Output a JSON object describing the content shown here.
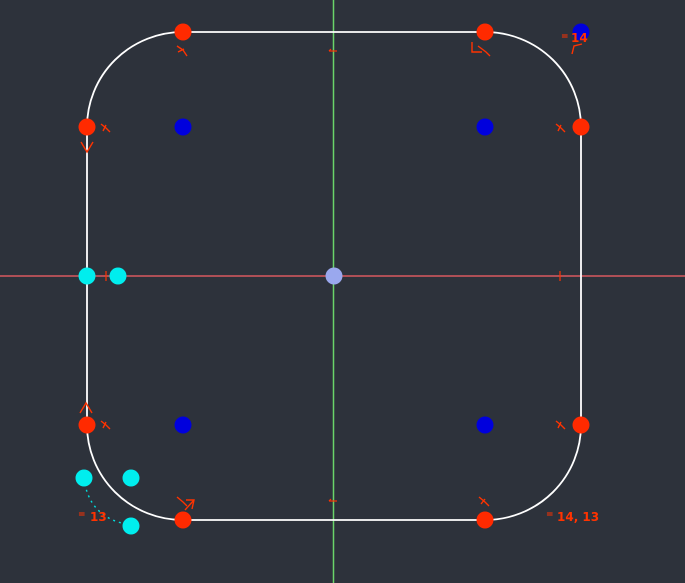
{
  "colors": {
    "background": "#2d323b",
    "outline": "#ffffff",
    "vertical_axis": "#6ad46a",
    "horizontal_axis": "#d9595f",
    "endpoint": "#ff2a00",
    "arc_center": "#0000dd",
    "origin_point": "#9aa8ee",
    "selected_point": "#00eeee",
    "constraint": "#ff3300",
    "selected_constraint": "#00dddd"
  },
  "constraints": {
    "radius_top_right": "14",
    "radius_bottom_left": "13",
    "radius_bottom_right": "14, 13",
    "equal_symbol": "="
  }
}
